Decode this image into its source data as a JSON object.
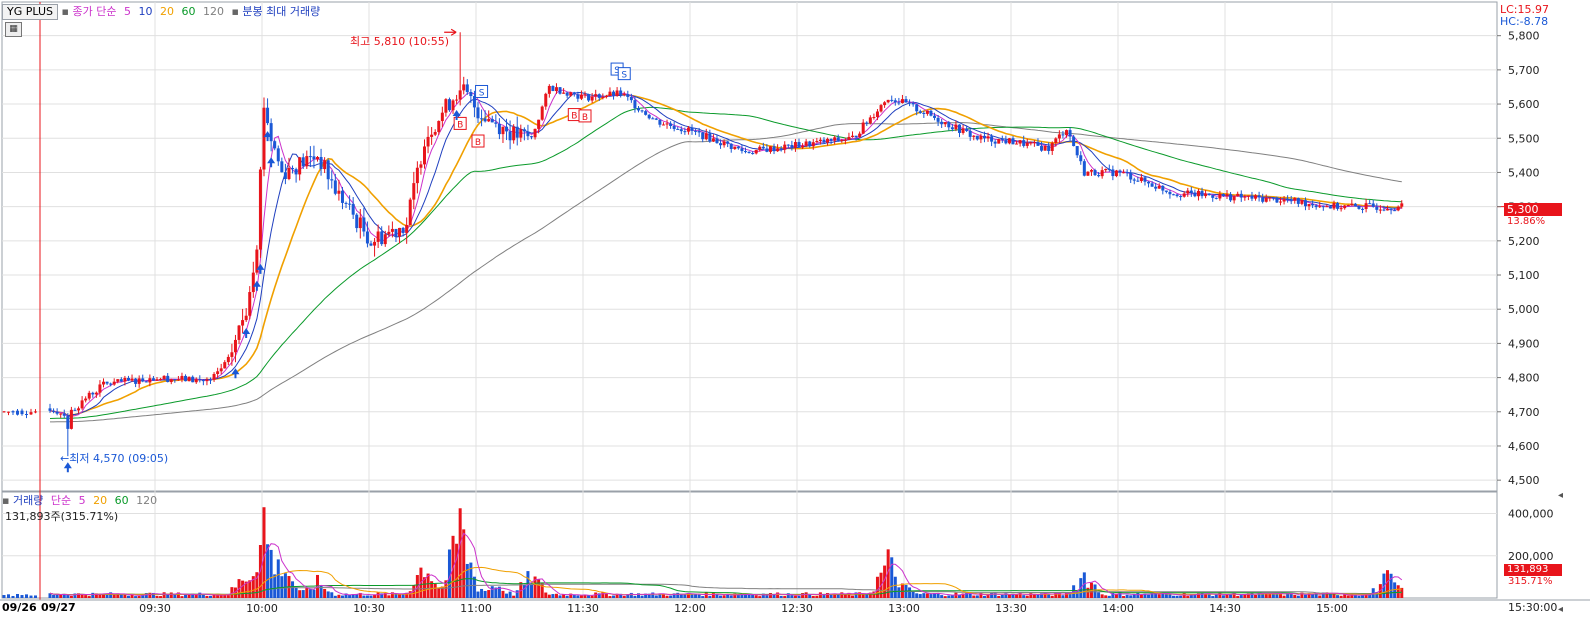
{
  "price_panel": {
    "ticker": "YG PLUS",
    "legend": [
      {
        "text": "종가 단순",
        "color": "#cc33cc"
      },
      {
        "text": "5",
        "color": "#cc33cc"
      },
      {
        "text": "10",
        "color": "#1f3fbf"
      },
      {
        "text": "20",
        "color": "#f0a000"
      },
      {
        "text": "60",
        "color": "#0a9a2a"
      },
      {
        "text": "120",
        "color": "#808080"
      },
      {
        "text": "분봉 최대 거래량",
        "color": "#1f3fbf"
      }
    ],
    "lc_label": "LC:15.97",
    "hc_label": "HC:-8.78",
    "current_price": "5,300",
    "current_change": "13.86%",
    "high_annotation": "최고 5,810 (10:55)",
    "low_annotation": "←최저 4,570 (09:05)"
  },
  "volume_panel": {
    "legend": [
      {
        "text": "거래량",
        "color": "#1f3fbf"
      },
      {
        "text": "단순",
        "color": "#cc33cc"
      },
      {
        "text": "5",
        "color": "#cc33cc"
      },
      {
        "text": "20",
        "color": "#f0a000"
      },
      {
        "text": "60",
        "color": "#0a9a2a"
      },
      {
        "text": "120",
        "color": "#808080"
      }
    ],
    "info": "131,893주(315.71%)",
    "current_volume": "131,893",
    "current_ratio": "315.71%"
  },
  "x_axis": {
    "date_labels": [
      "09/26",
      "09/27"
    ],
    "end_label": "15:30:00"
  },
  "colors": {
    "up": "#e8141b",
    "down": "#1a58d6",
    "ma5": "#cc33cc",
    "ma10": "#1f3fbf",
    "ma20": "#f0a000",
    "ma60": "#0a9a2a",
    "ma120": "#808080",
    "grid": "#e0e0e0"
  },
  "chart_data": [
    {
      "type": "candlestick",
      "title": "YG PLUS",
      "x_ticks": [
        "09:30",
        "10:00",
        "10:30",
        "11:00",
        "11:30",
        "12:00",
        "12:30",
        "13:00",
        "13:30",
        "14:00",
        "14:30",
        "15:00"
      ],
      "y_ticks": [
        4500,
        4600,
        4700,
        4800,
        4900,
        5000,
        5100,
        5200,
        5300,
        5400,
        5500,
        5600,
        5700,
        5800
      ],
      "ylim": [
        4480,
        5840
      ],
      "grid": true,
      "high": {
        "value": 5810,
        "time": "10:55"
      },
      "low": {
        "value": 4570,
        "time": "09:05"
      },
      "last": 5300,
      "buy_markers": [
        "10:55",
        "11:00",
        "11:27",
        "11:30"
      ],
      "sell_markers": [
        "11:01",
        "11:39",
        "11:41"
      ],
      "close_path": [
        {
          "t": "09:00",
          "p": 4710
        },
        {
          "t": "09:05",
          "p": 4690
        },
        {
          "t": "09:10",
          "p": 4740
        },
        {
          "t": "09:15",
          "p": 4780
        },
        {
          "t": "09:30",
          "p": 4800
        },
        {
          "t": "09:45",
          "p": 4790
        },
        {
          "t": "09:50",
          "p": 4850
        },
        {
          "t": "09:55",
          "p": 5000
        },
        {
          "t": "09:58",
          "p": 5200
        },
        {
          "t": "10:00",
          "p": 5600
        },
        {
          "t": "10:02",
          "p": 5500
        },
        {
          "t": "10:05",
          "p": 5400
        },
        {
          "t": "10:15",
          "p": 5450
        },
        {
          "t": "10:20",
          "p": 5350
        },
        {
          "t": "10:30",
          "p": 5200
        },
        {
          "t": "10:40",
          "p": 5250
        },
        {
          "t": "10:45",
          "p": 5500
        },
        {
          "t": "10:55",
          "p": 5650
        },
        {
          "t": "11:00",
          "p": 5580
        },
        {
          "t": "11:10",
          "p": 5510
        },
        {
          "t": "11:15",
          "p": 5500
        },
        {
          "t": "11:20",
          "p": 5650
        },
        {
          "t": "11:30",
          "p": 5620
        },
        {
          "t": "11:40",
          "p": 5630
        },
        {
          "t": "11:50",
          "p": 5550
        },
        {
          "t": "12:00",
          "p": 5520
        },
        {
          "t": "12:15",
          "p": 5460
        },
        {
          "t": "12:30",
          "p": 5480
        },
        {
          "t": "12:45",
          "p": 5500
        },
        {
          "t": "12:55",
          "p": 5620
        },
        {
          "t": "13:00",
          "p": 5600
        },
        {
          "t": "13:10",
          "p": 5550
        },
        {
          "t": "13:20",
          "p": 5500
        },
        {
          "t": "13:30",
          "p": 5490
        },
        {
          "t": "13:40",
          "p": 5470
        },
        {
          "t": "13:45",
          "p": 5530
        },
        {
          "t": "13:50",
          "p": 5400
        },
        {
          "t": "14:00",
          "p": 5400
        },
        {
          "t": "14:15",
          "p": 5340
        },
        {
          "t": "14:30",
          "p": 5330
        },
        {
          "t": "14:45",
          "p": 5320
        },
        {
          "t": "15:00",
          "p": 5300
        },
        {
          "t": "15:15",
          "p": 5300
        }
      ]
    },
    {
      "type": "bar",
      "title": "거래량",
      "y_ticks": [
        200000,
        400000
      ],
      "ylim": [
        0,
        450000
      ],
      "last": 131893,
      "volume_profile": [
        {
          "t": "09:05",
          "v": 20000
        },
        {
          "t": "09:55",
          "v": 150000
        },
        {
          "t": "10:00",
          "v": 420000
        },
        {
          "t": "10:05",
          "v": 230000
        },
        {
          "t": "10:15",
          "v": 100000
        },
        {
          "t": "10:45",
          "v": 220000
        },
        {
          "t": "10:55",
          "v": 420000
        },
        {
          "t": "11:05",
          "v": 90000
        },
        {
          "t": "11:15",
          "v": 140000
        },
        {
          "t": "12:55",
          "v": 230000
        },
        {
          "t": "13:00",
          "v": 60000
        },
        {
          "t": "13:50",
          "v": 150000
        },
        {
          "t": "14:00",
          "v": 30000
        },
        {
          "t": "15:15",
          "v": 131893
        }
      ]
    }
  ]
}
